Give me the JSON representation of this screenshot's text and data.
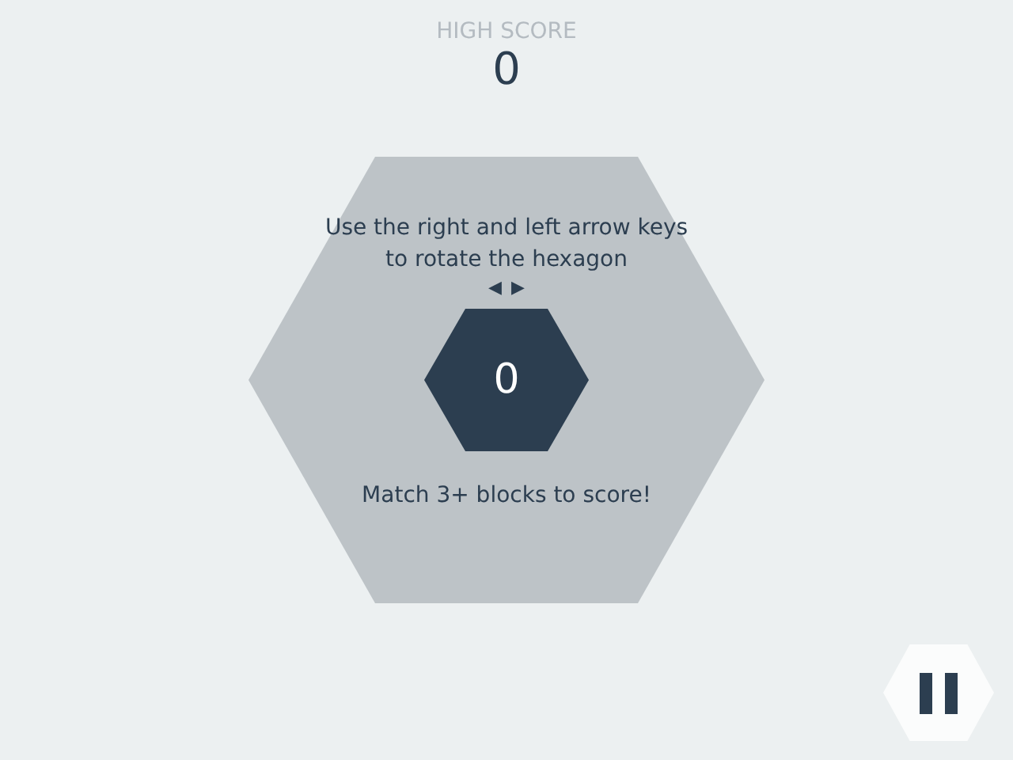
{
  "high_score": {
    "label": "HIGH SCORE",
    "value": "0"
  },
  "instructions": [
    "Use the right and left arrow keys",
    "to rotate the hexagon"
  ],
  "arrow_keys": [
    "◀",
    "▶"
  ],
  "score": "0",
  "hint": "Match 3+ blocks to score!"
}
